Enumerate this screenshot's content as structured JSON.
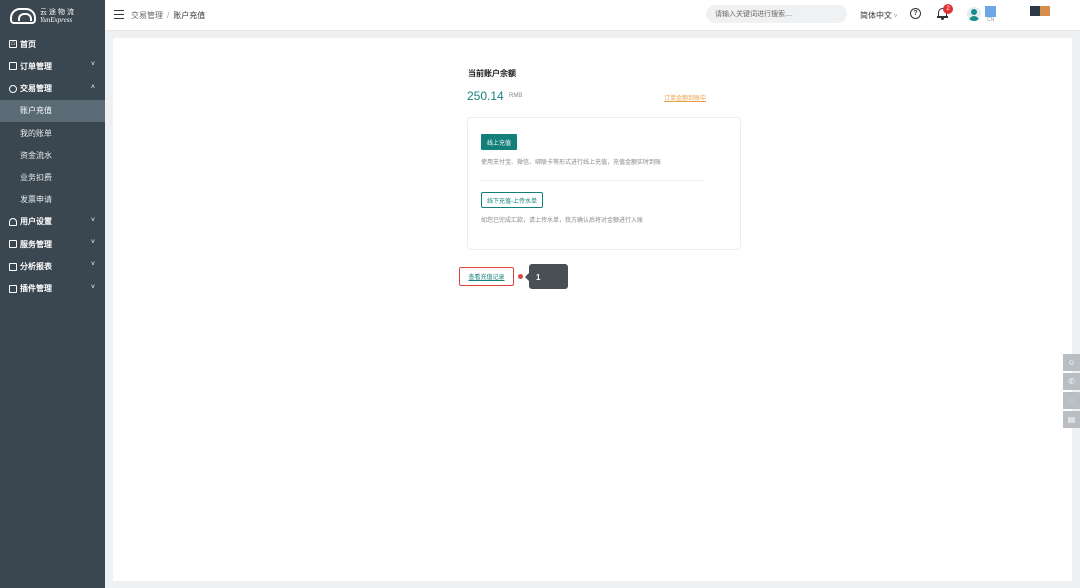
{
  "logo": {
    "cn": "云途物流",
    "en": "YunExpress"
  },
  "sidebar": {
    "home": "首页",
    "order": "订单管理",
    "trade": "交易管理",
    "trade_children": [
      "账户充值",
      "我的账单",
      "资金流水",
      "业务扣费",
      "发票申请"
    ],
    "user": "用户设置",
    "service": "服务管理",
    "analytics": "分析报表",
    "plugin": "插件管理"
  },
  "header": {
    "breadcrumb_parent": "交易管理",
    "breadcrumb_sep": "/",
    "breadcrumb_current": "账户充值",
    "search_placeholder": "请输入关键词进行搜索....",
    "language": "简体中文",
    "notification_count": "2",
    "region": "CN"
  },
  "balance": {
    "title": "当前账户余额",
    "amount": "250.14",
    "unit": "RMB",
    "link": "订单金额到账中"
  },
  "recharge": {
    "online_button": "线上充值",
    "online_desc": "使用支付宝、微信、绑联卡等形式进行线上充值，充值金额实时到账",
    "offline_button": "线下充值-上传水单",
    "offline_desc": "如您已完成汇款，请上传水单，我方确认后将对金额进行入账"
  },
  "record_link": "查看充值记录",
  "tooltip": {
    "step": "1"
  },
  "colors": {
    "sidebar": "#3a4650",
    "accent": "#127f7a",
    "warning": "#e9a04b",
    "highlight": "#e0443c"
  },
  "side_tools": [
    "robot-icon",
    "phone-icon",
    "chat-icon",
    "feedback-icon"
  ]
}
